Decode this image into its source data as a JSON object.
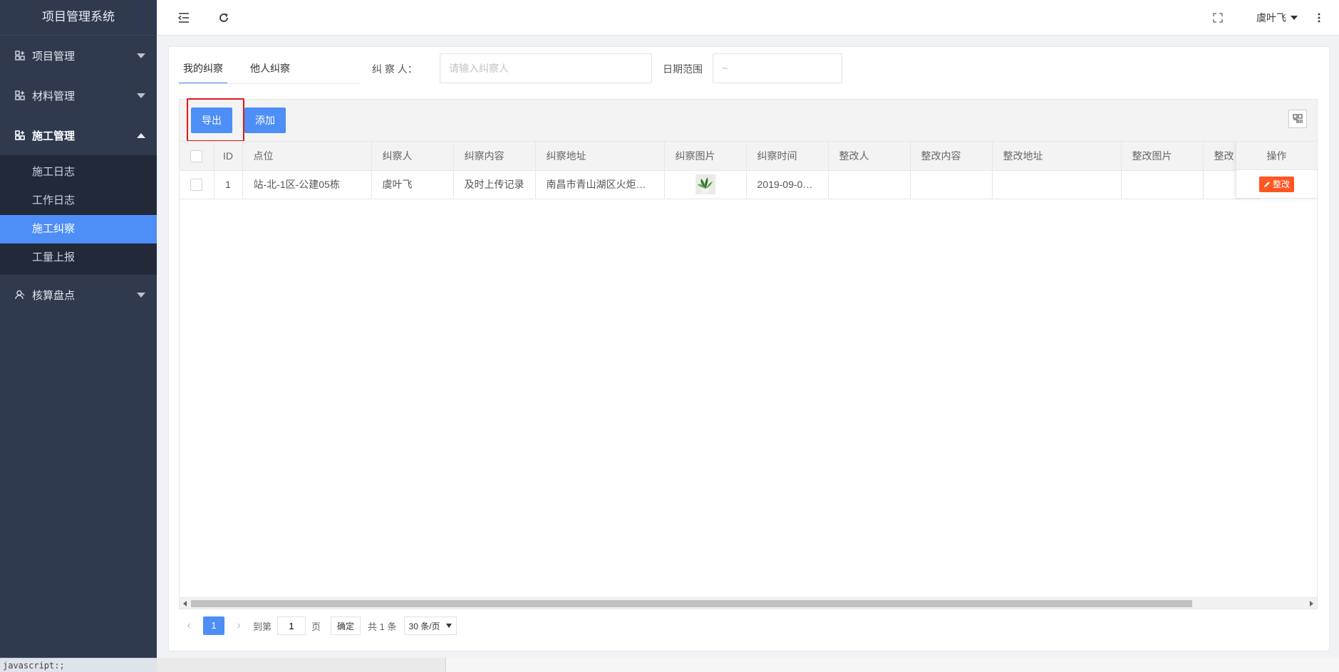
{
  "app": {
    "title": "项目管理系统"
  },
  "sidebar": {
    "groups": [
      {
        "label": "项目管理",
        "icon": "apps-icon",
        "expanded": false
      },
      {
        "label": "材料管理",
        "icon": "apps-icon",
        "expanded": false
      },
      {
        "label": "施工管理",
        "icon": "apps-icon",
        "expanded": true,
        "items": [
          "施工日志",
          "工作日志",
          "施工纠察",
          "工量上报"
        ],
        "selected": "施工纠察"
      },
      {
        "label": "核算盘点",
        "icon": "user-icon",
        "expanded": false
      }
    ]
  },
  "status_bar": {
    "text": "javascript:;"
  },
  "header": {
    "user_name": "虞叶飞"
  },
  "tabs": [
    {
      "label": "我的纠察",
      "active": true
    },
    {
      "label": "他人纠察",
      "active": false
    }
  ],
  "filters": {
    "inspector_label": "纠 察 人：",
    "inspector_placeholder": "请输入纠察人",
    "date_label": "日期范围",
    "date_value": "~"
  },
  "toolbar": {
    "export_label": "导出",
    "add_label": "添加"
  },
  "table": {
    "columns": [
      "ID",
      "点位",
      "纠察人",
      "纠察内容",
      "纠察地址",
      "纠察图片",
      "纠察时间",
      "整改人",
      "整改内容",
      "整改地址",
      "整改图片",
      "整改"
    ],
    "action_header": "操作",
    "rows": [
      {
        "id": "1",
        "point": "站-北-1区-公建05栋",
        "inspector": "虞叶飞",
        "content": "及时上传记录",
        "address": "南昌市青山湖区火炬…",
        "image": "plant-photo",
        "time": "2019-09-0…",
        "rectifier": "",
        "rect_content": "",
        "rect_address": "",
        "rect_image": "",
        "rect_status": "",
        "action": "整改"
      }
    ]
  },
  "pager": {
    "current": "1",
    "goto_label": "到第",
    "goto_value": "1",
    "page_unit": "页",
    "confirm": "确定",
    "total": "共 1 条",
    "page_size": "30 条/页"
  },
  "colors": {
    "primary": "#4d8ef7",
    "danger": "#ff5722",
    "sidebar_bg": "#2f3a4f",
    "highlight": "#e8141a"
  }
}
